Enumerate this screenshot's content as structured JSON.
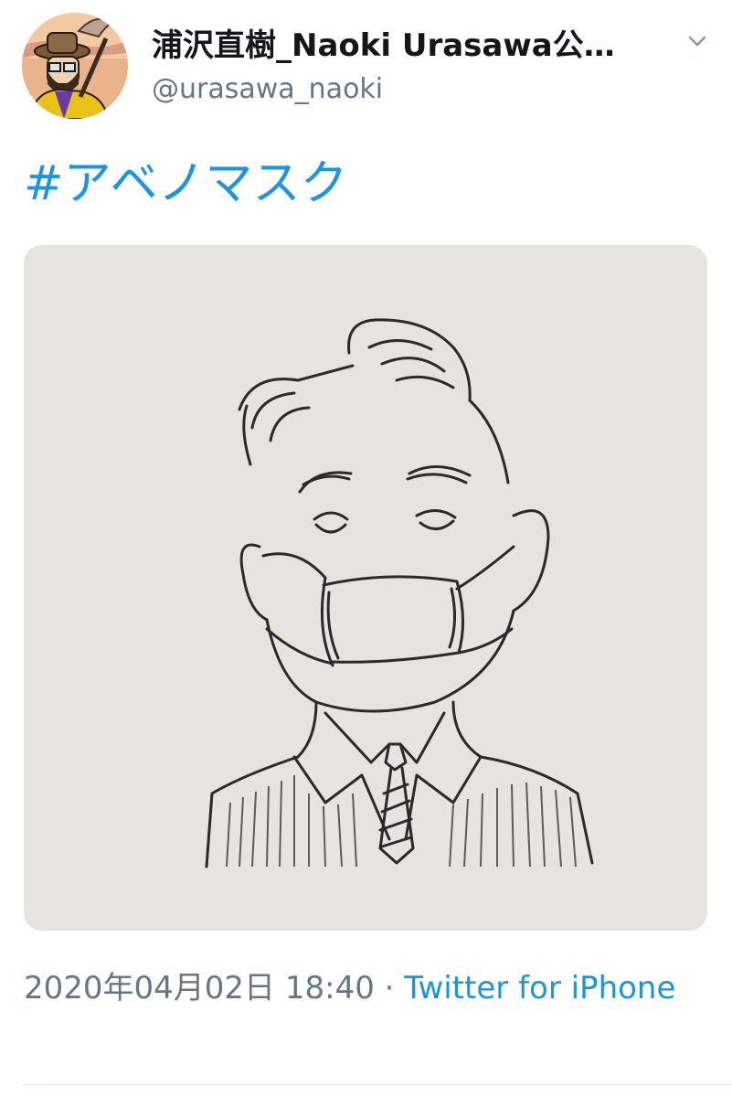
{
  "tweet": {
    "author": {
      "display_name": "浦沢直樹_Naoki Urasawa公…",
      "handle": "@urasawa_naoki"
    },
    "text": "#アベノマスク",
    "timestamp": "2020年04月02日 18:40",
    "separator": "·",
    "source": "Twitter for iPhone"
  },
  "colors": {
    "link_blue": "#1b95e0",
    "text_dark": "#14171a",
    "text_gray": "#657786",
    "divider": "#e1e8ed"
  },
  "icons": {
    "more_options": "chevron-down-icon"
  }
}
